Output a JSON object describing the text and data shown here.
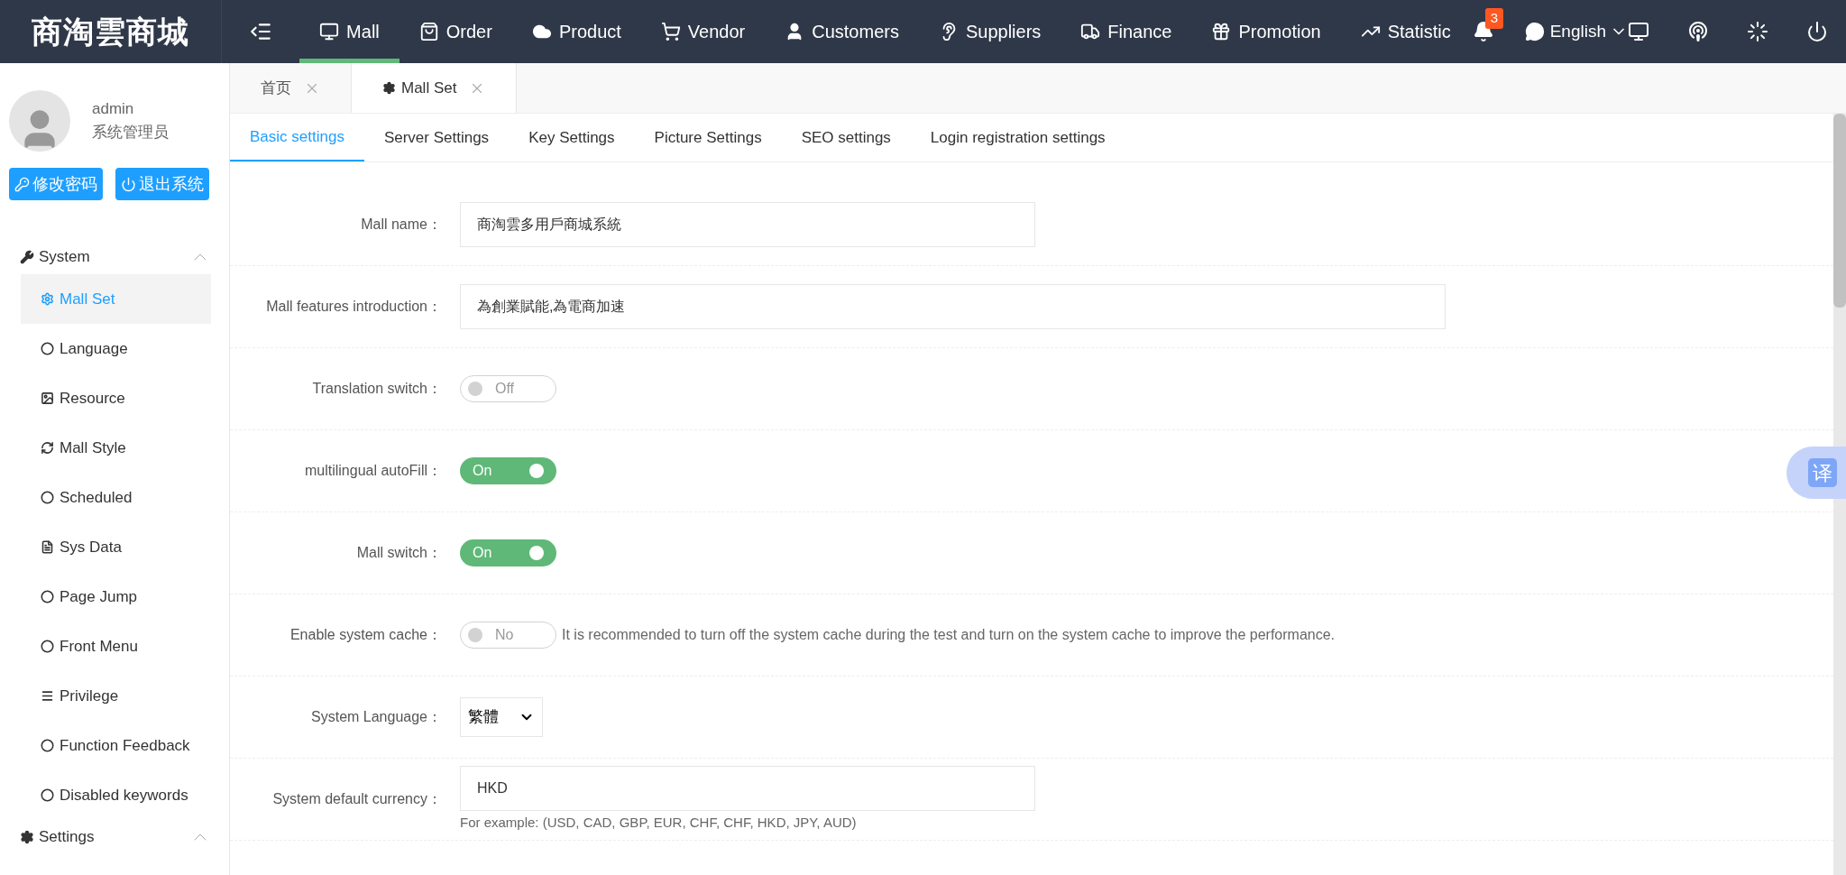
{
  "top_bar": {
    "logo": "商淘雲商城",
    "nav": [
      {
        "label": "Mall",
        "selected": true
      },
      {
        "label": "Order",
        "selected": false
      },
      {
        "label": "Product",
        "selected": false
      },
      {
        "label": "Vendor",
        "selected": false
      },
      {
        "label": "Customers",
        "selected": false
      },
      {
        "label": "Suppliers",
        "selected": false
      },
      {
        "label": "Finance",
        "selected": false
      },
      {
        "label": "Promotion",
        "selected": false
      },
      {
        "label": "Statistic",
        "selected": false
      }
    ],
    "notification_count": "3",
    "language": "English"
  },
  "sidebar": {
    "user": {
      "name": "admin",
      "role": "系统管理员"
    },
    "buttons": [
      "修改密码",
      "退出系统"
    ],
    "groups": [
      {
        "label": "System",
        "expanded": true,
        "children": [
          {
            "label": "Mall Set",
            "selected": true
          },
          {
            "label": "Language",
            "selected": false
          },
          {
            "label": "Resource",
            "selected": false
          },
          {
            "label": "Mall Style",
            "selected": false
          },
          {
            "label": "Scheduled",
            "selected": false
          },
          {
            "label": "Sys Data",
            "selected": false
          },
          {
            "label": "Page Jump",
            "selected": false
          },
          {
            "label": "Front Menu",
            "selected": false
          },
          {
            "label": "Privilege",
            "selected": false
          },
          {
            "label": "Function Feedback",
            "selected": false
          },
          {
            "label": "Disabled keywords",
            "selected": false
          }
        ]
      },
      {
        "label": "Settings",
        "expanded": true
      }
    ]
  },
  "page_tabs": [
    {
      "label": "首页",
      "selected": false
    },
    {
      "label": "Mall Set",
      "selected": true
    }
  ],
  "settings_tabs": [
    {
      "label": "Basic settings",
      "selected": true
    },
    {
      "label": "Server Settings",
      "selected": false
    },
    {
      "label": "Key Settings",
      "selected": false
    },
    {
      "label": "Picture Settings",
      "selected": false
    },
    {
      "label": "SEO settings",
      "selected": false
    },
    {
      "label": "Login registration settings",
      "selected": false
    }
  ],
  "form": [
    {
      "kind": "text",
      "label": "Mall name：",
      "value": "商淘雲多用戶商城系統",
      "wide": false
    },
    {
      "kind": "text",
      "label": "Mall features introduction：",
      "value": "為創業賦能,為電商加速",
      "wide": true
    },
    {
      "kind": "toggle",
      "label": "Translation switch：",
      "on": false,
      "state_text": "Off"
    },
    {
      "kind": "toggle",
      "label": "multilingual autoFill：",
      "on": true,
      "state_text": "On"
    },
    {
      "kind": "toggle",
      "label": "Mall switch：",
      "on": true,
      "state_text": "On"
    },
    {
      "kind": "toggle",
      "label": "Enable system cache：",
      "on": false,
      "state_text": "No",
      "note": "It is recommended to turn off the system cache during the test and turn on the system cache to improve the performance."
    },
    {
      "kind": "select",
      "label": "System Language：",
      "value": "繁體"
    },
    {
      "kind": "text",
      "label": "System default currency：",
      "value": "HKD",
      "wide": false,
      "hint": "For example: (USD, CAD, GBP, EUR, CHF, CHF, HKD, JPY, AUD)"
    }
  ],
  "translate_button": "译"
}
